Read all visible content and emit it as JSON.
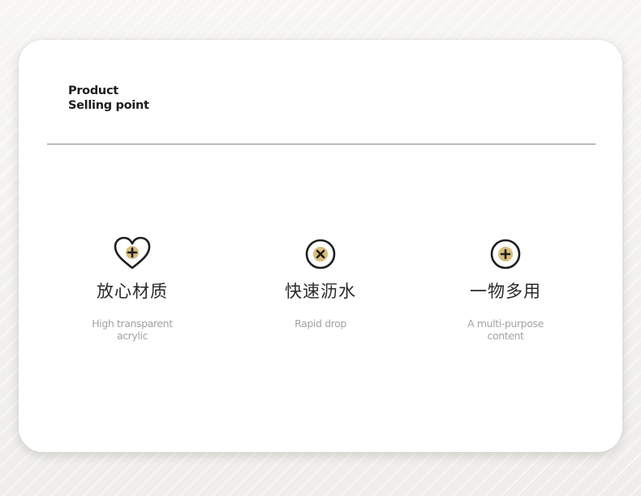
{
  "header": {
    "line1": "Product",
    "line2": "Selling point"
  },
  "features": [
    {
      "icon": "heart-plus-icon",
      "title": "放心材质",
      "desc_line1": "High transparent",
      "desc_line2": "acrylic"
    },
    {
      "icon": "circle-x-icon",
      "title": "快速沥水",
      "desc_line1": "Rapid drop",
      "desc_line2": ""
    },
    {
      "icon": "circle-plus-icon",
      "title": "一物多用",
      "desc_line1": "A multi-purpose",
      "desc_line2": "content"
    }
  ],
  "colors": {
    "icon_stroke": "#1e1e1e",
    "icon_fill": "#d9bd7a",
    "title": "#2a2a2a",
    "desc": "#a3a3a3"
  }
}
